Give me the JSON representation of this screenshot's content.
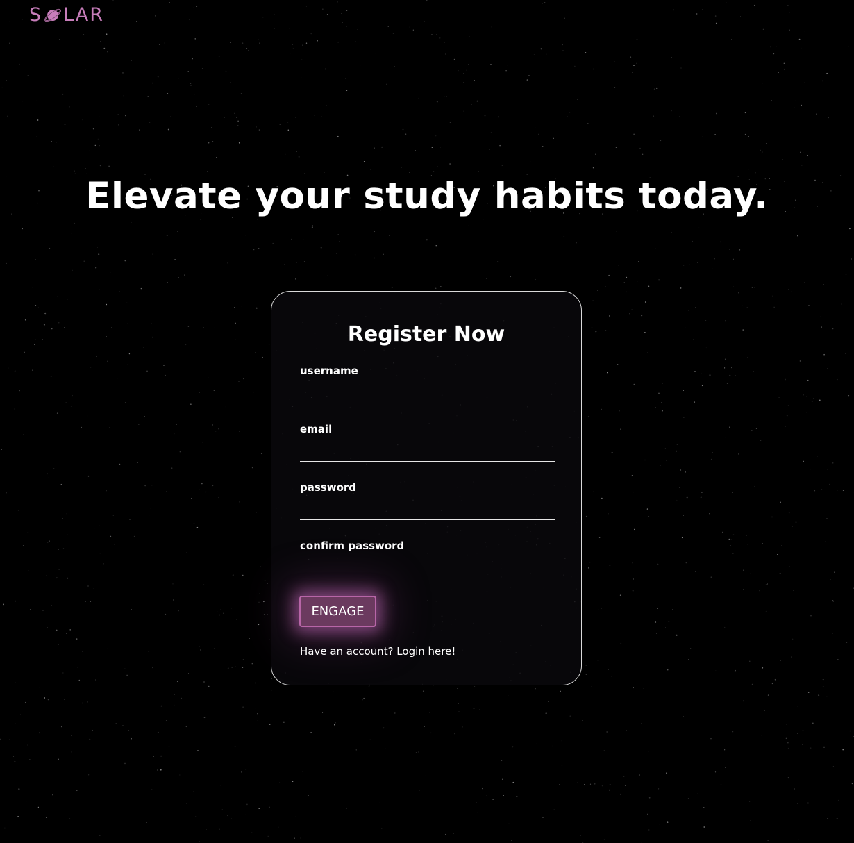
{
  "brand": {
    "logo_left": "S",
    "logo_right": "LAR",
    "logo_icon": "planet-icon",
    "accent_color": "#c77dba"
  },
  "hero": {
    "headline": "Elevate your study habits today."
  },
  "register_form": {
    "title": "Register Now",
    "fields": [
      {
        "label": "username",
        "value": ""
      },
      {
        "label": "email",
        "value": ""
      },
      {
        "label": "password",
        "value": ""
      },
      {
        "label": "confirm password",
        "value": ""
      }
    ],
    "submit_label": "ENGAGE",
    "login_prompt": "Have an account? Login here!",
    "button_color": "#6b3a5f"
  }
}
